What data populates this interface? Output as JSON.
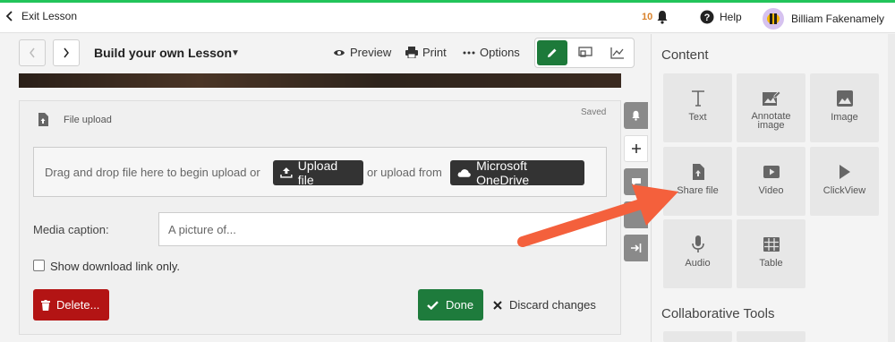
{
  "topbar": {
    "exit_label": "Exit Lesson",
    "notification_count": "10",
    "help_label": "Help",
    "user_name": "Billiam Fakenamely"
  },
  "toolbar": {
    "lesson_title": "Build your own Lesson",
    "preview_label": "Preview",
    "print_label": "Print",
    "options_label": "Options"
  },
  "file_upload": {
    "section_label": "File upload",
    "status": "Saved",
    "drop_text": "Drag and drop file here to begin upload or",
    "upload_button": "Upload file",
    "or_text": "or upload from",
    "onedrive_button": "Microsoft OneDrive",
    "caption_label": "Media caption:",
    "caption_placeholder": "A picture of...",
    "checkbox_label": "Show download link only.",
    "delete_button": "Delete...",
    "done_button": "Done",
    "discard_button": "Discard changes"
  },
  "panel": {
    "content_title": "Content",
    "tiles": [
      {
        "label": "Text",
        "icon": "text-icon"
      },
      {
        "label": "Annotate image",
        "icon": "annotate-image-icon"
      },
      {
        "label": "Image",
        "icon": "image-icon"
      },
      {
        "label": "Share file",
        "icon": "share-file-icon"
      },
      {
        "label": "Video",
        "icon": "video-icon"
      },
      {
        "label": "ClickView",
        "icon": "play-icon"
      },
      {
        "label": "Audio",
        "icon": "microphone-icon"
      },
      {
        "label": "Table",
        "icon": "table-icon"
      }
    ],
    "collab_title": "Collaborative Tools"
  },
  "colors": {
    "accent_green": "#1d7a3a",
    "danger_red": "#b31414",
    "annotation_arrow": "#f4603c",
    "notification_orange": "#d9822b"
  }
}
